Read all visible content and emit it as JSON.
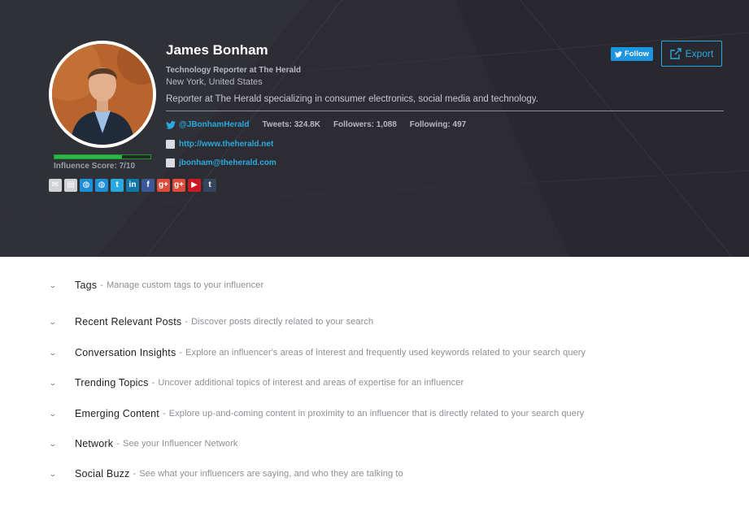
{
  "profile": {
    "name": "James Bonham",
    "title": "Technology Reporter at The Herald",
    "location": "New York, United States",
    "bio": "Reporter at The Herald specializing in consumer electronics, social media and technology.",
    "twitter_handle": "@JBonhamHerald",
    "tweets": "Tweets: 324.8K",
    "followers": "Followers: 1,088",
    "following": "Following: 497",
    "website": "http://www.theherald.net",
    "email": "jbonham@theherald.com",
    "influence_score_label": "Influence Score: 7/10",
    "influence_score": 0.7
  },
  "actions": {
    "follow_label": "Follow",
    "export_label": "Export"
  },
  "social_icons": [
    {
      "name": "email-icon",
      "color": "#d0d2d6",
      "glyph": "✉"
    },
    {
      "name": "document-icon",
      "color": "#d0d2d6",
      "glyph": "▤"
    },
    {
      "name": "globe-icon",
      "color": "#1d8fd6",
      "glyph": "◍"
    },
    {
      "name": "globe-icon-2",
      "color": "#1d8fd6",
      "glyph": "◍"
    },
    {
      "name": "twitter-icon",
      "color": "#2aa9e0",
      "glyph": "t"
    },
    {
      "name": "linkedin-icon",
      "color": "#0e76a8",
      "glyph": "in"
    },
    {
      "name": "facebook-icon",
      "color": "#3b5998",
      "glyph": "f"
    },
    {
      "name": "google-plus-icon",
      "color": "#dd4b39",
      "glyph": "g+"
    },
    {
      "name": "google-plus-icon-2",
      "color": "#dd4b39",
      "glyph": "g+"
    },
    {
      "name": "youtube-icon",
      "color": "#cc181e",
      "glyph": "▶"
    },
    {
      "name": "tumblr-icon",
      "color": "#35465c",
      "glyph": "t"
    }
  ],
  "sections": [
    {
      "title": "Tags",
      "desc": "Manage custom tags to your influencer"
    },
    {
      "title": "Recent Relevant Posts",
      "desc": "Discover posts directly related to your search"
    },
    {
      "title": "Conversation Insights",
      "desc": "Explore an influencer's areas of interest and frequently used keywords related to your search query"
    },
    {
      "title": "Trending Topics",
      "desc": "Uncover additional topics of interest and areas of expertise for an influencer"
    },
    {
      "title": "Emerging Content",
      "desc": "Explore up-and-coming content in proximity to an influencer that is directly related to your search query"
    },
    {
      "title": "Network",
      "desc": "See your Influencer Network"
    },
    {
      "title": "Social Buzz",
      "desc": "See what your influencers are saying, and who they are talking to"
    }
  ]
}
